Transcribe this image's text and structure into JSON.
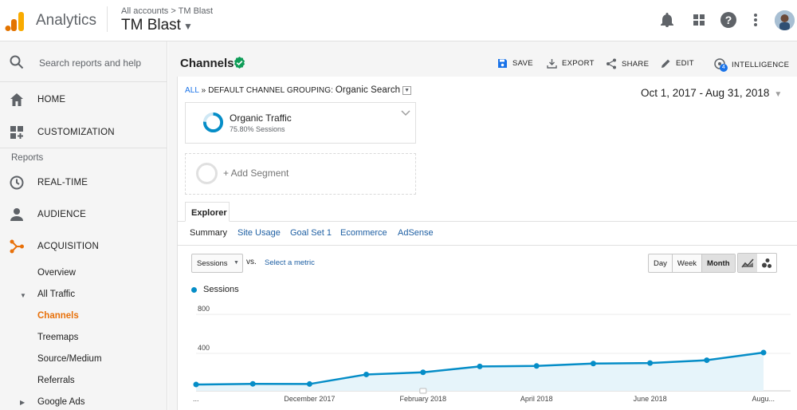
{
  "app": {
    "name": "Analytics",
    "breadcrumb": "All accounts > TM Blast",
    "account": "TM Blast"
  },
  "topbar_icons": [
    "bell-icon",
    "apps-grid-icon",
    "help-icon",
    "more-vert-icon",
    "avatar"
  ],
  "sidebar": {
    "search_placeholder": "Search reports and help",
    "nav": [
      {
        "label": "HOME",
        "icon": "home-icon"
      },
      {
        "label": "CUSTOMIZATION",
        "icon": "dashboard-icon"
      }
    ],
    "reports_heading": "Reports",
    "reports": [
      {
        "label": "REAL-TIME",
        "icon": "clock-icon"
      },
      {
        "label": "AUDIENCE",
        "icon": "person-icon"
      },
      {
        "label": "ACQUISITION",
        "icon": "acquisition-icon"
      }
    ],
    "acquisition_items": [
      "Overview",
      "All Traffic",
      "Channels",
      "Treemaps",
      "Source/Medium",
      "Referrals",
      "Google Ads"
    ]
  },
  "header": {
    "title": "Channels",
    "actions": [
      "SAVE",
      "EXPORT",
      "SHARE",
      "EDIT",
      "INTELLIGENCE"
    ],
    "intelligence_badge": "4"
  },
  "breadcrumb": {
    "all": "ALL",
    "sep": "»",
    "grouping_label": "DEFAULT CHANNEL GROUPING:",
    "grouping_value": "Organic Search"
  },
  "date_range": "Oct 1, 2017 - Aug 31, 2018",
  "segment": {
    "name": "Organic Traffic",
    "detail": "75.80% Sessions",
    "add_label": "+ Add Segment"
  },
  "tabs": {
    "explorer": "Explorer",
    "subtabs": [
      "Summary",
      "Site Usage",
      "Goal Set 1",
      "Ecommerce",
      "AdSense"
    ]
  },
  "controls": {
    "metric": "Sessions",
    "vs": "vs.",
    "select_metric": "Select a metric",
    "periods": [
      "Day",
      "Week",
      "Month"
    ],
    "active_period": "Month"
  },
  "colors": {
    "series": "#058dc7",
    "fill": "#e6f4fa",
    "accent": "#e8710a",
    "brand_check": "#0f9d58"
  },
  "chart_data": {
    "type": "area",
    "series": [
      {
        "name": "Sessions",
        "values": [
          65,
          72,
          70,
          168,
          190,
          250,
          255,
          280,
          285,
          314,
          392
        ]
      }
    ],
    "x": [
      "...",
      "Nov 2017",
      "December 2017",
      "Jan 2018",
      "February 2018",
      "Mar 2018",
      "April 2018",
      "May 2018",
      "June 2018",
      "Jul 2018",
      "Augu..."
    ],
    "x_tick_labels": [
      "...",
      "December 2017",
      "February 2018",
      "April 2018",
      "June 2018",
      "Augu..."
    ],
    "y_ticks": [
      "800",
      "400"
    ],
    "ylim": [
      0,
      850
    ],
    "grid": true
  }
}
